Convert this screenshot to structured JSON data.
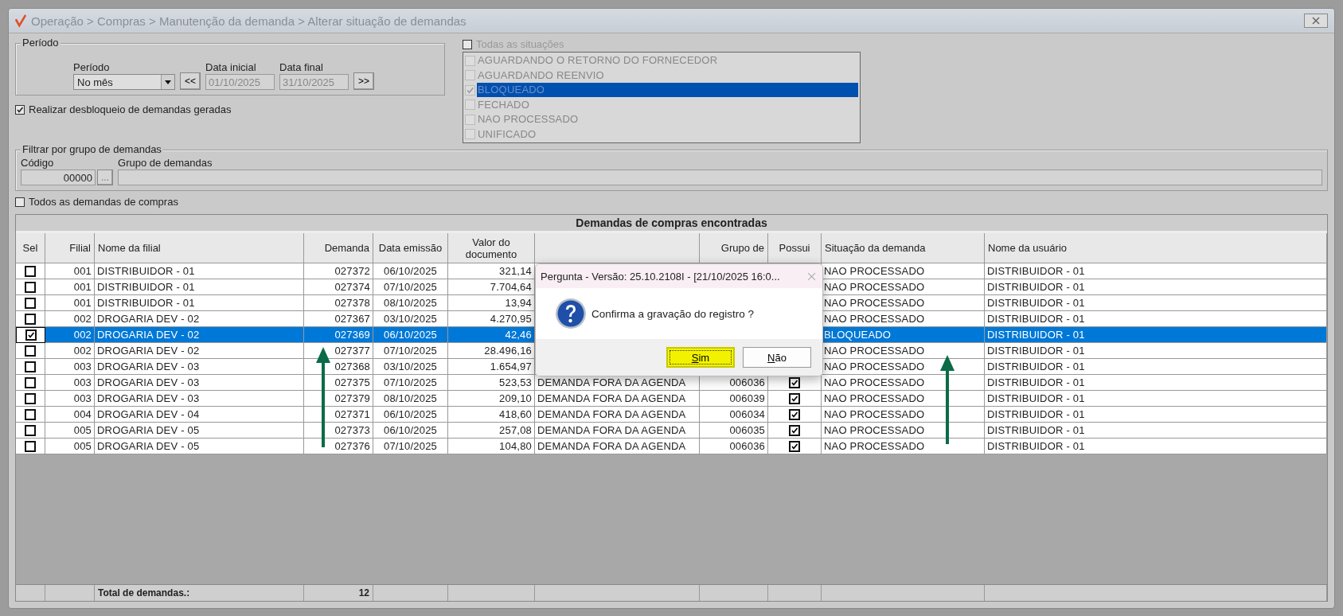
{
  "window": {
    "title": "Operação > Compras > Manutenção da demanda > Alterar situação de demandas"
  },
  "periodo": {
    "legend": "Período",
    "period_label": "Período",
    "period_value": "No mês",
    "prev_button": "<<",
    "start_label": "Data inicial",
    "start_value": "01/10/2025",
    "end_label": "Data final",
    "end_value": "31/10/2025",
    "next_button": ">>"
  },
  "unlock_option": {
    "label": "Realizar desbloqueio de demandas geradas",
    "checked": true
  },
  "situations": {
    "all_label": "Todas as situações",
    "all_checked": false,
    "items": [
      {
        "label": "AGUARDANDO O RETORNO DO FORNECEDOR",
        "checked": false,
        "selected": false
      },
      {
        "label": "AGUARDANDO REENVIO",
        "checked": false,
        "selected": false
      },
      {
        "label": "BLOQUEADO",
        "checked": true,
        "selected": true
      },
      {
        "label": "FECHADO",
        "checked": false,
        "selected": false
      },
      {
        "label": "NAO PROCESSADO",
        "checked": false,
        "selected": false
      },
      {
        "label": "UNIFICADO",
        "checked": false,
        "selected": false
      }
    ]
  },
  "group_filter": {
    "legend": "Filtrar por grupo de demandas",
    "code_label": "Código",
    "code_value": "00000",
    "lookup_button": "...",
    "group_label": "Grupo de demandas"
  },
  "all_demands_option": {
    "label": "Todos as demandas de compras",
    "checked": false
  },
  "table": {
    "title": "Demandas de compras encontradas",
    "columns": {
      "sel": "Sel",
      "filial": "Filial",
      "nome_filial": "Nome da filial",
      "demanda": "Demanda",
      "data_emissao": "Data emissão",
      "valor": "Valor do documento",
      "grupo": "Grupo de",
      "possui": "Possui",
      "situacao": "Situação da demanda",
      "usuario": "Nome da usuário"
    },
    "rows": [
      {
        "checked": false,
        "selected": false,
        "filial": "001",
        "nome_filial": "DISTRIBUIDOR - 01",
        "demanda": "027372",
        "data_emissao": "06/10/2025",
        "valor": "321,14",
        "situacao": "NAO PROCESSADO",
        "usuario": "DISTRIBUIDOR - 01"
      },
      {
        "checked": false,
        "selected": false,
        "filial": "001",
        "nome_filial": "DISTRIBUIDOR - 01",
        "demanda": "027374",
        "data_emissao": "07/10/2025",
        "valor": "7.704,64",
        "situacao": "NAO PROCESSADO",
        "usuario": "DISTRIBUIDOR - 01"
      },
      {
        "checked": false,
        "selected": false,
        "filial": "001",
        "nome_filial": "DISTRIBUIDOR - 01",
        "demanda": "027378",
        "data_emissao": "08/10/2025",
        "valor": "13,94",
        "situacao": "NAO PROCESSADO",
        "usuario": "DISTRIBUIDOR - 01"
      },
      {
        "checked": false,
        "selected": false,
        "filial": "002",
        "nome_filial": "DROGARIA DEV - 02",
        "demanda": "027367",
        "data_emissao": "03/10/2025",
        "valor": "4.270,95",
        "situacao": "NAO PROCESSADO",
        "usuario": "DISTRIBUIDOR - 01"
      },
      {
        "checked": true,
        "selected": true,
        "filial": "002",
        "nome_filial": "DROGARIA DEV - 02",
        "demanda": "027369",
        "data_emissao": "06/10/2025",
        "valor": "42,46",
        "situacao": "BLOQUEADO",
        "usuario": "DISTRIBUIDOR - 01"
      },
      {
        "checked": false,
        "selected": false,
        "filial": "002",
        "nome_filial": "DROGARIA DEV - 02",
        "demanda": "027377",
        "data_emissao": "07/10/2025",
        "valor": "28.496,16",
        "situacao": "NAO PROCESSADO",
        "usuario": "DISTRIBUIDOR - 01"
      },
      {
        "checked": false,
        "selected": false,
        "filial": "003",
        "nome_filial": "DROGARIA DEV - 03",
        "demanda": "027368",
        "data_emissao": "03/10/2025",
        "valor": "1.654,97",
        "situacao": "NAO PROCESSADO",
        "usuario": "DISTRIBUIDOR - 01"
      },
      {
        "checked": false,
        "selected": false,
        "filial": "003",
        "nome_filial": "DROGARIA DEV - 03",
        "demanda": "027375",
        "data_emissao": "07/10/2025",
        "valor": "523,53",
        "column_5": "DEMANDA FORA DA AGENDA",
        "grupo": "006036",
        "possui": true,
        "situacao": "NAO PROCESSADO",
        "usuario": "DISTRIBUIDOR - 01"
      },
      {
        "checked": false,
        "selected": false,
        "filial": "003",
        "nome_filial": "DROGARIA DEV - 03",
        "demanda": "027379",
        "data_emissao": "08/10/2025",
        "valor": "209,10",
        "column_5": "DEMANDA FORA DA AGENDA",
        "grupo": "006039",
        "possui": true,
        "situacao": "NAO PROCESSADO",
        "usuario": "DISTRIBUIDOR - 01"
      },
      {
        "checked": false,
        "selected": false,
        "filial": "004",
        "nome_filial": "DROGARIA DEV - 04",
        "demanda": "027371",
        "data_emissao": "06/10/2025",
        "valor": "418,60",
        "column_5": "DEMANDA FORA DA AGENDA",
        "grupo": "006034",
        "possui": true,
        "situacao": "NAO PROCESSADO",
        "usuario": "DISTRIBUIDOR - 01"
      },
      {
        "checked": false,
        "selected": false,
        "filial": "005",
        "nome_filial": "DROGARIA DEV - 05",
        "demanda": "027373",
        "data_emissao": "06/10/2025",
        "valor": "257,08",
        "column_5": "DEMANDA FORA DA AGENDA",
        "grupo": "006035",
        "possui": true,
        "situacao": "NAO PROCESSADO",
        "usuario": "DISTRIBUIDOR - 01"
      },
      {
        "checked": false,
        "selected": false,
        "filial": "005",
        "nome_filial": "DROGARIA DEV - 05",
        "demanda": "027376",
        "data_emissao": "07/10/2025",
        "valor": "104,80",
        "column_5": "DEMANDA FORA DA AGENDA",
        "grupo": "006036",
        "possui": true,
        "situacao": "NAO PROCESSADO",
        "usuario": "DISTRIBUIDOR - 01"
      }
    ],
    "footer": {
      "label": "Total de demandas.:",
      "count": "12"
    }
  },
  "dialog": {
    "title": "Pergunta - Versão: 25.10.2108I - [21/10/2025 16:0...",
    "message": "Confirma a gravação do registro ?",
    "buttons": [
      {
        "label": "Sim",
        "focused": true
      },
      {
        "label": "Não",
        "focused": false
      }
    ]
  }
}
